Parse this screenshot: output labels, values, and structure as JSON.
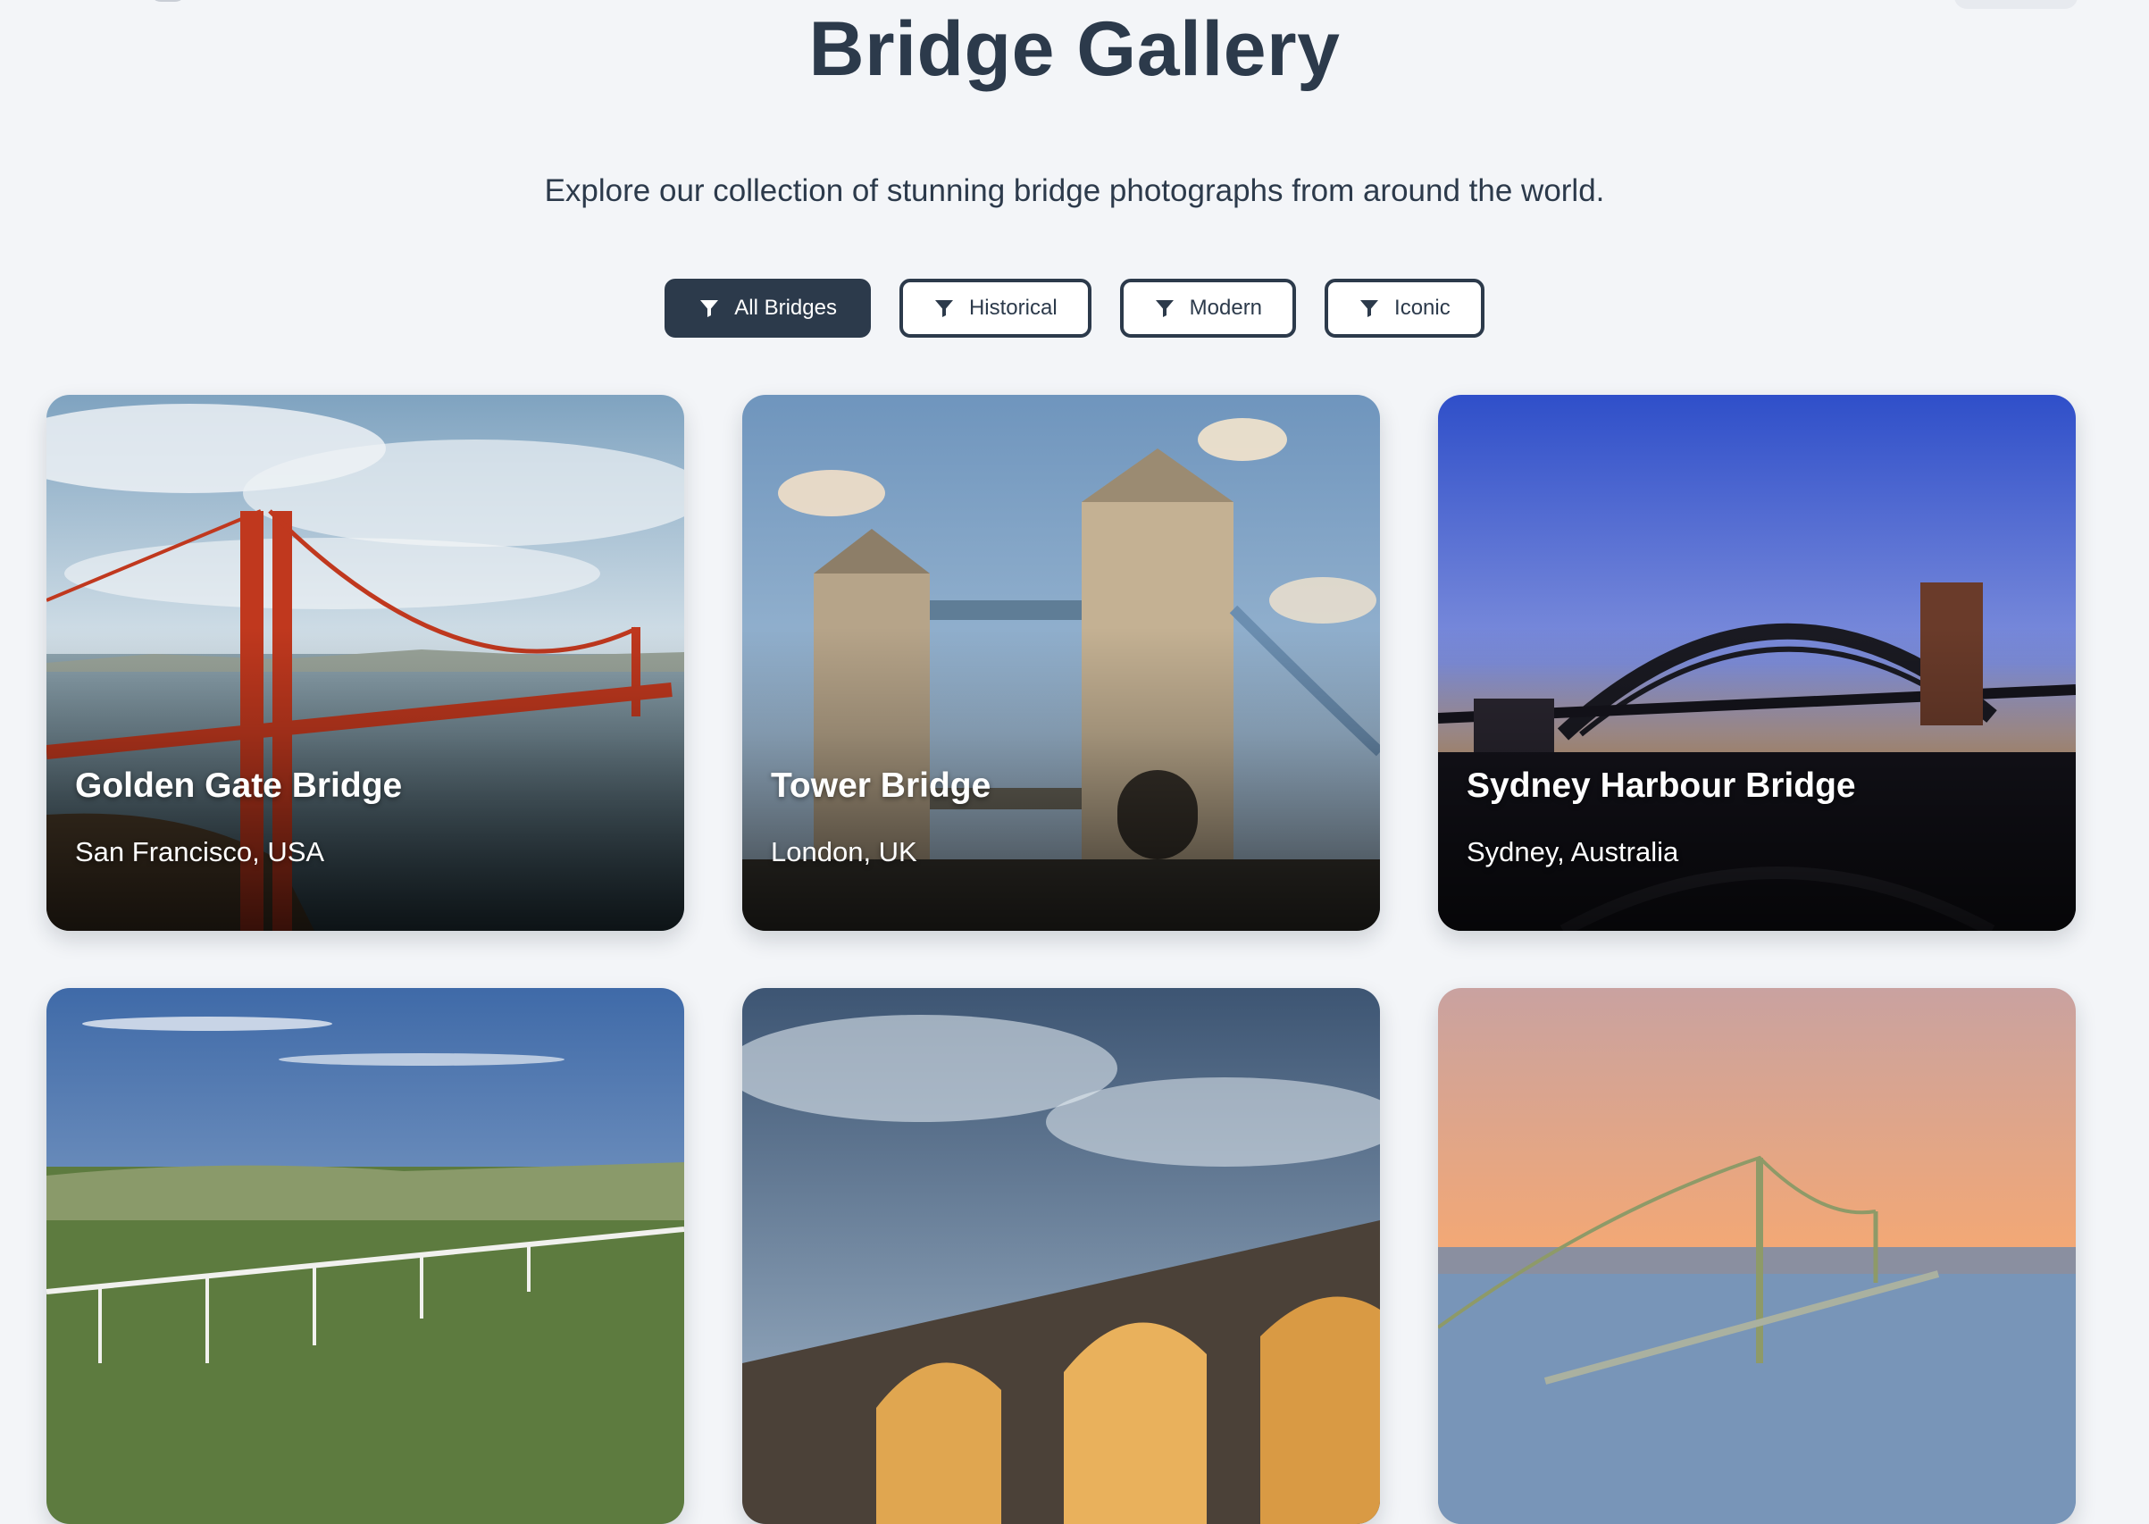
{
  "header": {
    "title": "Bridge Gallery",
    "subtitle": "Explore our collection of stunning bridge photographs from around the world."
  },
  "filters": [
    {
      "label": "All Bridges",
      "icon": "filter-icon",
      "active": true
    },
    {
      "label": "Historical",
      "icon": "filter-icon",
      "active": false
    },
    {
      "label": "Modern",
      "icon": "filter-icon",
      "active": false
    },
    {
      "label": "Iconic",
      "icon": "filter-icon",
      "active": false
    }
  ],
  "gallery": {
    "cards": [
      {
        "name": "Golden Gate Bridge",
        "location": "San Francisco, USA"
      },
      {
        "name": "Tower Bridge",
        "location": "London, UK"
      },
      {
        "name": "Sydney Harbour Bridge",
        "location": "Sydney, Australia"
      },
      {
        "name": "",
        "location": ""
      },
      {
        "name": "",
        "location": ""
      },
      {
        "name": "",
        "location": ""
      }
    ]
  },
  "colors": {
    "background": "#f3f5f8",
    "primary": "#2c3a4b",
    "active_filter_bg": "#2c3a4b",
    "active_filter_text": "#ffffff"
  }
}
